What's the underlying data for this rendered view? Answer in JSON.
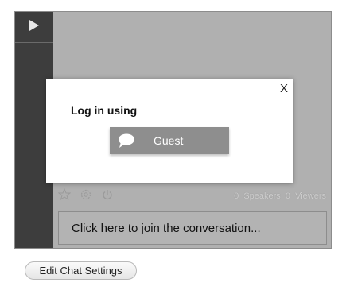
{
  "modal": {
    "close_label": "X",
    "title": "Log in using",
    "guest_label": "Guest"
  },
  "toolbar": {
    "icons": [
      "pin-icon",
      "gear-icon",
      "power-icon"
    ],
    "speakers_count": "0",
    "speakers_label": "Speakers",
    "viewers_count": "0",
    "viewers_label": "Viewers"
  },
  "join": {
    "prompt": "Click here to join the conversation..."
  },
  "footer": {
    "edit_button": "Edit Chat Settings"
  },
  "colors": {
    "sidebar": "#3d3d3d",
    "widget_bg": "#b0b0b0",
    "guest_button": "#8e8e8e"
  }
}
